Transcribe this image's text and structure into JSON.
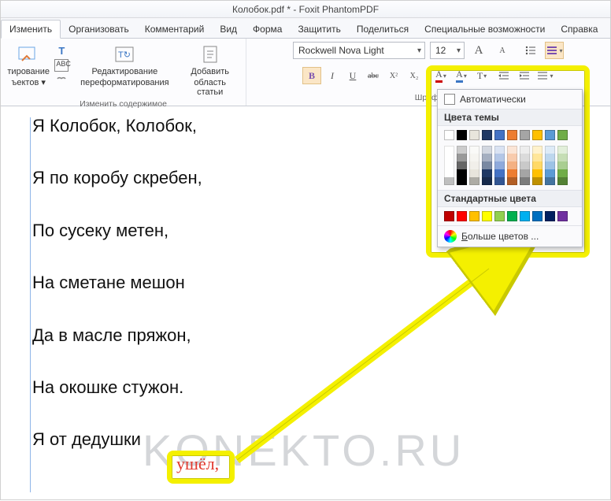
{
  "title": "Колобок.pdf * - Foxit PhantomPDF",
  "tabs": [
    "Изменить",
    "Организовать",
    "Комментарий",
    "Вид",
    "Форма",
    "Защитить",
    "Поделиться",
    "Специальные возможности",
    "Справка"
  ],
  "ribbon": {
    "edit_objects": {
      "line1": "тирование",
      "line2": "ъектов ▾"
    },
    "edit_text": "T",
    "abc_icon": "ABC",
    "reflow": {
      "line1": "Редактирование",
      "line2": "переформатирования"
    },
    "add_article": {
      "line1": "Добавить",
      "line2": "область статьи"
    },
    "group1_label": "Изменить содержимое",
    "font_name": "Rockwell Nova Light",
    "font_size": "12",
    "b": "B",
    "i": "I",
    "u": "U",
    "strike": "abc",
    "sup": "X²",
    "sub": "X₂",
    "font_color": "A",
    "highlight": "A",
    "case": "T",
    "shrink": "A",
    "grow": "A",
    "indent_dec": "≡",
    "indent_inc": "≡",
    "group2_label": "Шрифт",
    "list_bullet": "≡",
    "list_num": "≡",
    "align": "≡"
  },
  "color_popup": {
    "automatic": "Автоматически",
    "theme_header": "Цвета темы",
    "theme_colors_row": [
      "#ffffff",
      "#000000",
      "#e8e5dc",
      "#1f3864",
      "#4472c4",
      "#ed7d31",
      "#a5a5a5",
      "#ffc000",
      "#5b9bd5",
      "#70ad47"
    ],
    "standard_header": "Стандартные цвета",
    "standard_colors": [
      "#c00000",
      "#ff0000",
      "#ffc000",
      "#ffff00",
      "#92d050",
      "#00b050",
      "#00b0f0",
      "#0070c0",
      "#002060",
      "#7030a0"
    ],
    "more": "Больше цветов ..."
  },
  "document": {
    "lines": [
      "Я Колобок, Колобок,",
      "Я по коробу скребен,",
      "По сусеку метен,",
      "На сметане мешон",
      "Да в масле пряжон,",
      "На окошке стужон.",
      "Я от дедушки"
    ],
    "highlighted_word": "ушёл,"
  },
  "watermark": "KONEKTO.RU"
}
